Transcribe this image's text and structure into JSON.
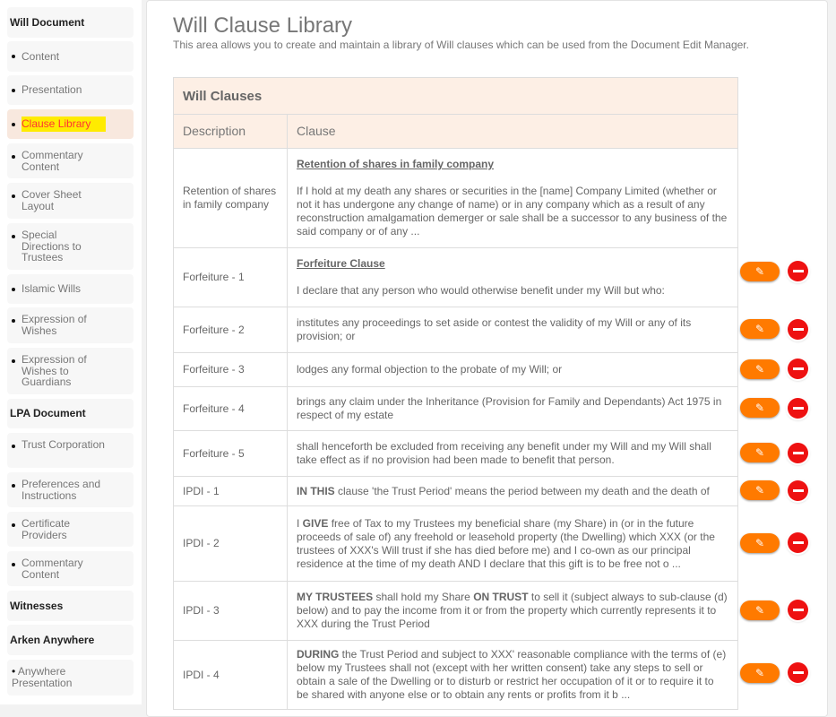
{
  "sidebar": [
    {
      "label": "Will Document",
      "type": "head"
    },
    {
      "label": "Content",
      "type": "item"
    },
    {
      "label": "Presentation",
      "type": "item"
    },
    {
      "label": "Clause Library",
      "type": "item",
      "active": true
    },
    {
      "label": "Commentary Content",
      "type": "item"
    },
    {
      "label": "Cover Sheet Layout",
      "type": "item"
    },
    {
      "label": "Special Directions to Trustees",
      "type": "item"
    },
    {
      "label": "Islamic Wills",
      "type": "item"
    },
    {
      "label": "Expression of Wishes",
      "type": "item"
    },
    {
      "label": "Expression of Wishes to Guardians",
      "type": "item"
    },
    {
      "label": "LPA Document",
      "type": "head"
    },
    {
      "label": "Trust Corporation",
      "type": "item"
    },
    {
      "label": "Preferences and Instructions",
      "type": "item"
    },
    {
      "label": "Certificate Providers",
      "type": "item"
    },
    {
      "label": "Commentary Content",
      "type": "item"
    },
    {
      "label": "Witnesses",
      "type": "head"
    },
    {
      "label": "Arken Anywhere",
      "type": "head"
    },
    {
      "label": "Anywhere Presentation",
      "type": "item"
    }
  ],
  "page": {
    "title": "Will Clause Library",
    "intro": "This area allows you to create and maintain a library of Will clauses which can be used from the Document Edit Manager."
  },
  "table": {
    "title": "Will Clauses",
    "columns": [
      "Description",
      "Clause"
    ],
    "rows": [
      {
        "description": "Retention of shares in family company",
        "heading": "Retention of shares in family company",
        "segments": [
          {
            "t": " If I hold at my death any shares or securities in the [name] Company Limited (whether or not it has undergone any change of name) or in any company which as a result of any reconstruction amalgamation demerger or sale shall be a successor to any business of the said company or of any ..."
          }
        ],
        "actions": false
      },
      {
        "description": "Forfeiture - 1",
        "heading": "Forfeiture Clause",
        "segments": [
          {
            "t": "I declare that any person who would otherwise benefit under my Will but who:"
          }
        ],
        "actions": true
      },
      {
        "description": "Forfeiture - 2",
        "segments": [
          {
            "t": "institutes any proceedings to set aside or contest the validity of my Will or any of its provision; or"
          }
        ],
        "actions": true
      },
      {
        "description": "Forfeiture - 3",
        "segments": [
          {
            "t": "lodges any formal objection to the probate of my Will; or"
          }
        ],
        "actions": true
      },
      {
        "description": "Forfeiture - 4",
        "segments": [
          {
            "t": "brings any claim under the Inheritance (Provision for Family and Dependants) Act 1975 in respect of my estate"
          }
        ],
        "actions": true
      },
      {
        "description": "Forfeiture - 5",
        "segments": [
          {
            "t": "shall henceforth be excluded from receiving any benefit under my Will and my Will shall take effect as if no provision had been made to benefit that person."
          }
        ],
        "actions": true
      },
      {
        "description": "IPDI - 1",
        "segments": [
          {
            "t": "IN THIS",
            "b": true
          },
          {
            "t": " clause 'the Trust Period' means the period between my death and the death of"
          }
        ],
        "actions": true
      },
      {
        "description": "IPDI - 2",
        "segments": [
          {
            "t": "I "
          },
          {
            "t": "GIVE",
            "b": true
          },
          {
            "t": " free of Tax to my Trustees my beneficial share (my Share) in (or in the future proceeds of sale of) any freehold or leasehold property (the Dwelling) which XXX (or the trustees of XXX's Will trust if she has died before me) and I co-own as our principal residence at the time of my death AND I declare that this gift is to be free not o ..."
          }
        ],
        "actions": true
      },
      {
        "description": "IPDI - 3",
        "segments": [
          {
            "t": "MY TRUSTEES",
            "b": true
          },
          {
            "t": " shall hold my Share "
          },
          {
            "t": "ON TRUST",
            "b": true
          },
          {
            "t": " to sell it (subject always to sub-clause (d) below) and to pay the income from it or from the property which currently represents it to XXX during the Trust Period"
          }
        ],
        "actions": true
      },
      {
        "description": "IPDI - 4",
        "segments": [
          {
            "t": "DURING",
            "b": true
          },
          {
            "t": " the Trust Period and subject to XXX' reasonable compliance with the terms of (e) below my Trustees shall not (except with her written consent) take any steps to sell or obtain a sale of the Dwelling or to disturb or restrict her occupation of it or to require it to be shared with anyone else or to obtain any rents or profits from it b ..."
          }
        ],
        "actions": true
      }
    ]
  },
  "colors": {
    "accent": "#ff7a00",
    "delete": "#ee1111",
    "header_bg": "#fdefe5",
    "highlight": "#ffeb00"
  }
}
